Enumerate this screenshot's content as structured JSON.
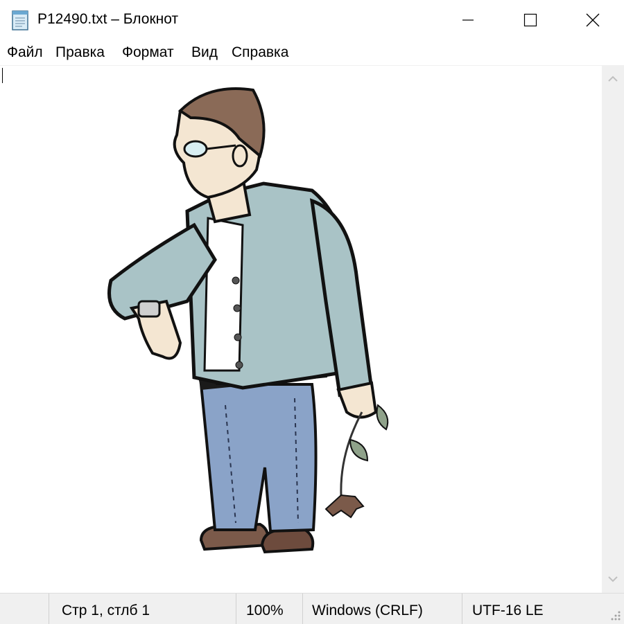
{
  "window": {
    "title": "P12490.txt – Блокнот",
    "icon": "notepad-icon",
    "controls": [
      "minimize-icon",
      "maximize-icon",
      "close-icon"
    ]
  },
  "menu": {
    "file": "Файл",
    "edit": "Правка",
    "format": "Формат",
    "view": "Вид",
    "help": "Справка"
  },
  "editor": {
    "content_type": "clipart-image",
    "scrollbar": [
      "chevron-up-icon",
      "chevron-down-icon"
    ]
  },
  "status": {
    "position": "Стр 1, стлб 1",
    "zoom": "100%",
    "line_endings": "Windows (CRLF)",
    "encoding": "UTF-16 LE"
  },
  "colors": {
    "jacket": "#a9c3c6",
    "jeans": "#8aa3c8",
    "hair": "#8a6a57",
    "skin": "#f4e6d2"
  }
}
